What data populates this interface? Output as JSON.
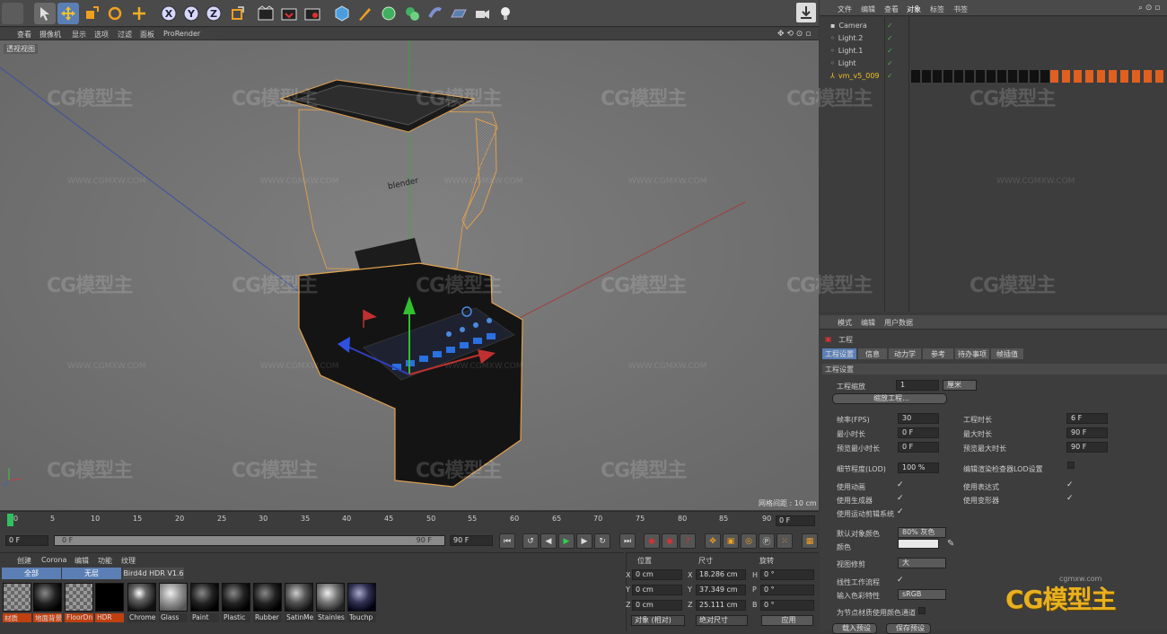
{
  "viewport": {
    "menu": [
      "查看",
      "摄像机",
      "显示",
      "选项",
      "过滤",
      "面板",
      "ProRender"
    ],
    "label": "透视视图",
    "grid_info": "网格间距 : 10 cm",
    "model_brand": "blender"
  },
  "timeline": {
    "ticks": [
      "0",
      "5",
      "10",
      "15",
      "20",
      "25",
      "30",
      "35",
      "40",
      "45",
      "50",
      "55",
      "60",
      "65",
      "70",
      "75",
      "80",
      "85",
      "90"
    ],
    "current_frame": "0 F",
    "start": "0 F",
    "range_start": "0 F",
    "range_end": "90 F",
    "end": "90 F"
  },
  "materials": {
    "menu": [
      "创建",
      "Corona",
      "编辑",
      "功能",
      "纹理"
    ],
    "filters": [
      "全部",
      "无层",
      "Bird4d HDR V1.6"
    ],
    "items": [
      "材质",
      "地面背景",
      "FloorDn",
      "HDR",
      "Chrome",
      "Glass",
      "Paint",
      "Plastic",
      "Rubber",
      "SatinMe",
      "Stainles",
      "Touchp"
    ]
  },
  "coords": {
    "headers": [
      "位置",
      "尺寸",
      "旋转"
    ],
    "axes": [
      "X",
      "Y",
      "Z"
    ],
    "rot_axes": [
      "H",
      "P",
      "B"
    ],
    "pos": [
      "0 cm",
      "0 cm",
      "0 cm"
    ],
    "size": [
      "18.286 cm",
      "37.349 cm",
      "25.111 cm"
    ],
    "rot": [
      "0 °",
      "0 °",
      "0 °"
    ],
    "mode": "对象 (相对)",
    "size_mode": "绝对尺寸",
    "apply": "应用"
  },
  "objects": {
    "menu": [
      "文件",
      "编辑",
      "查看",
      "对象",
      "标签",
      "书签"
    ],
    "items": [
      "Camera",
      "Light.2",
      "Light.1",
      "Light",
      "vm_v5_009"
    ]
  },
  "attributes": {
    "menu": [
      "模式",
      "编辑",
      "用户数据"
    ],
    "title": "工程",
    "tabs": [
      "工程设置",
      "信息",
      "动力学",
      "参考",
      "待办事项",
      "帧插值"
    ],
    "section": "工程设置",
    "scale_label": "工程缩放",
    "scale_value": "1",
    "scale_unit": "厘米",
    "scale_btn": "缩放工程...",
    "fps_label": "帧率(FPS)",
    "fps_value": "30",
    "duration_label": "工程时长",
    "duration_value": "6 F",
    "min_label": "最小时长",
    "min_value": "0 F",
    "max_label": "最大时长",
    "max_value": "90 F",
    "pmin_label": "预览最小时长",
    "pmin_value": "0 F",
    "pmax_label": "预览最大时长",
    "pmax_value": "90 F",
    "lod_label": "细节程度(LOD)",
    "lod_value": "100 %",
    "lod_check_label": "编辑渲染检查器LOD设置",
    "use_anim": "使用动画",
    "use_expr": "使用表达式",
    "use_gen": "使用生成器",
    "use_deform": "使用变形器",
    "use_motion": "使用运动剪辑系统",
    "obj_color_label": "默认对象颜色",
    "obj_color_value": "80% 灰色",
    "color_label": "颜色",
    "clip_label": "视图修剪",
    "clip_value": "大",
    "linear_label": "线性工作流程",
    "input_color_label": "输入色彩特性",
    "input_color_value": "sRGB",
    "node_label": "为节点材质使用颜色通道",
    "load_preset": "载入预设",
    "save_preset": "保存预设"
  },
  "watermark": {
    "logo": "CG模型主",
    "url": "WWW.CGMXW.COM",
    "corner_url": "cgmxw.com"
  }
}
